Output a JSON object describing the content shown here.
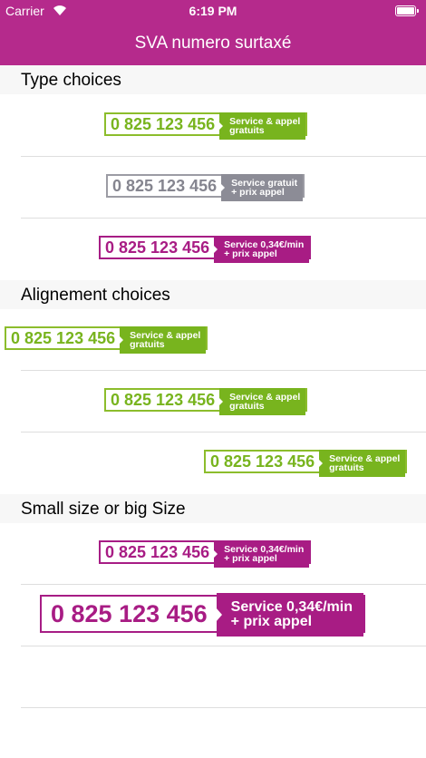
{
  "status_bar": {
    "carrier": "Carrier",
    "time": "6:19 PM",
    "wifi_icon": "wifi-icon",
    "battery_icon": "battery-icon"
  },
  "nav": {
    "title": "SVA numero surtaxé"
  },
  "sections": {
    "type": {
      "title": "Type choices"
    },
    "alignment": {
      "title": "Alignement choices"
    },
    "size": {
      "title": "Small size or big Size"
    }
  },
  "badges": {
    "type_gratuit": {
      "number": "0 825 123 456",
      "line1": "Service & appel",
      "line2": "gratuits"
    },
    "type_prix": {
      "number": "0 825 123 456",
      "line1": "Service gratuit",
      "line2": "+ prix appel"
    },
    "type_payant": {
      "number": "0 825 123 456",
      "line1": "Service 0,34€/min",
      "line2": "+ prix appel"
    },
    "align_left": {
      "number": "0 825 123 456",
      "line1": "Service & appel",
      "line2": "gratuits"
    },
    "align_center": {
      "number": "0 825 123 456",
      "line1": "Service & appel",
      "line2": "gratuits"
    },
    "align_right": {
      "number": "0 825 123 456",
      "line1": "Service & appel",
      "line2": "gratuits"
    },
    "size_small": {
      "number": "0 825 123 456",
      "line1": "Service 0,34€/min",
      "line2": "+ prix appel"
    },
    "size_big": {
      "number": "0 825 123 456",
      "line1": "Service 0,34€/min",
      "line2": "+ prix appel"
    }
  },
  "colors": {
    "accent": "#b52a8c",
    "green": "#78b41e",
    "grey": "#8c8c96",
    "purple": "#a81c84"
  }
}
